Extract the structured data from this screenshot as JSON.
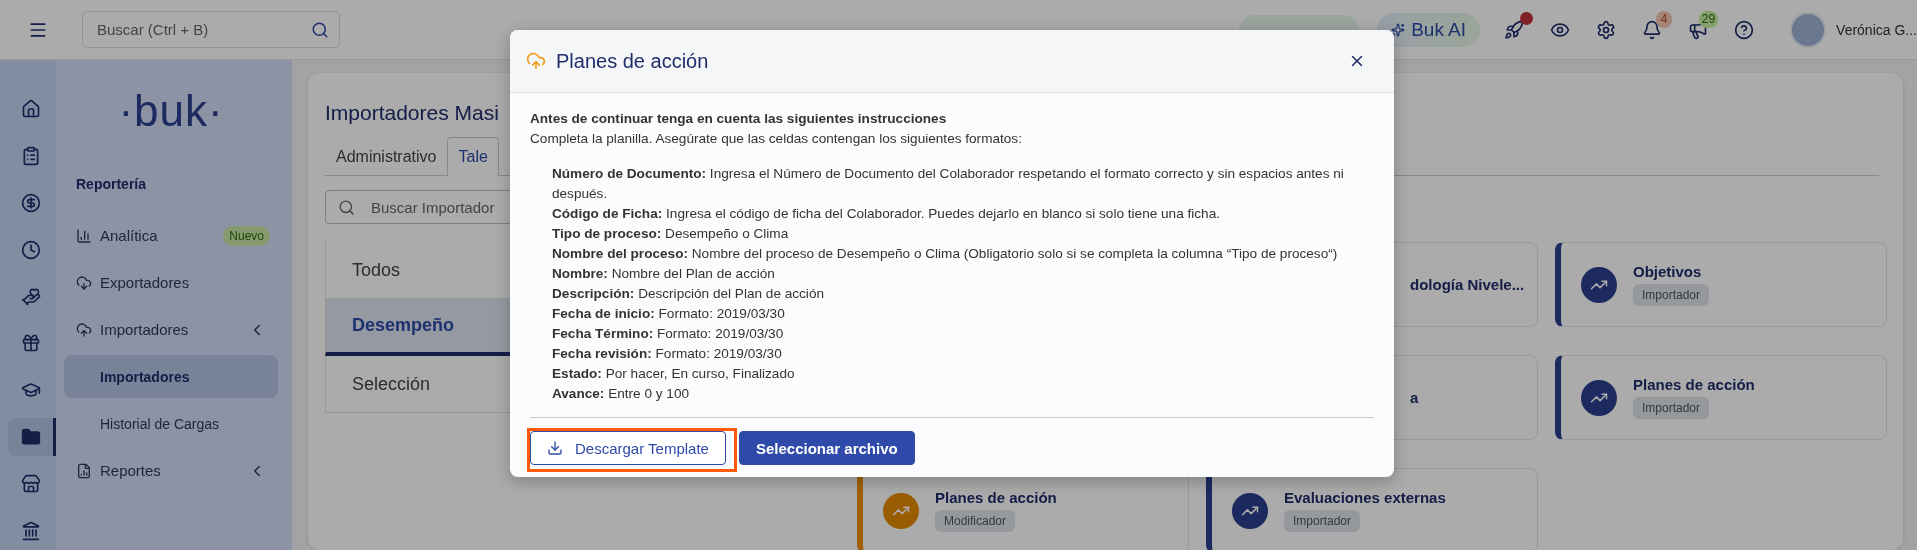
{
  "topbar": {
    "search": {
      "placeholder": "Buscar (Ctrl + B)"
    },
    "ai_button": "Buk AI",
    "actions": [
      {
        "kind": "rocket",
        "dot": true
      },
      {
        "kind": "eye"
      },
      {
        "kind": "gear"
      },
      {
        "kind": "bell",
        "count": "4"
      },
      {
        "kind": "megaphone",
        "count": "29"
      },
      {
        "kind": "help"
      }
    ],
    "user": {
      "name": "Verónica G..."
    }
  },
  "rail": [
    {
      "kind": "home",
      "selected": false
    },
    {
      "kind": "clipboard",
      "selected": false
    },
    {
      "kind": "dollar",
      "selected": false
    },
    {
      "kind": "clock",
      "selected": false
    },
    {
      "kind": "hand-heart",
      "selected": false
    },
    {
      "kind": "gift",
      "selected": false
    },
    {
      "kind": "cap",
      "selected": false
    },
    {
      "kind": "folder",
      "selected": true
    },
    {
      "kind": "store",
      "selected": false
    },
    {
      "kind": "bank",
      "selected": false
    }
  ],
  "sidebar": {
    "logo": "·buk·",
    "section": "Reportería",
    "items": [
      {
        "label": "Analítica",
        "kind": "chart",
        "badge": "Nuevo",
        "expandable": false
      },
      {
        "label": "Exportadores",
        "kind": "cloud-down",
        "expandable": false
      },
      {
        "label": "Importadores",
        "kind": "cloud-up",
        "expandable": true,
        "children": [
          {
            "label": "Importadores",
            "selected": true
          },
          {
            "label": "Historial de Cargas",
            "selected": false
          }
        ]
      },
      {
        "label": "Reportes",
        "kind": "report",
        "expandable": true
      }
    ]
  },
  "main": {
    "title": "Importadores Masi",
    "tabs": [
      {
        "label": "Administrativo",
        "selected": false
      },
      {
        "label": "Tale",
        "selected": true
      }
    ],
    "search": {
      "placeholder": "Buscar Importador"
    },
    "categories": [
      {
        "label": "Todos",
        "selected": false
      },
      {
        "label": "Desempeño",
        "selected": true
      },
      {
        "label": "Selección",
        "selected": false
      }
    ],
    "cards": [
      {
        "kind": "covered",
        "title": "dología Nivele..."
      },
      {
        "kind": "importer",
        "title": "Objetivos",
        "tag": "Importador"
      },
      {
        "kind": "covered",
        "title": "a"
      },
      {
        "kind": "importer",
        "title": "Planes de acción",
        "tag": "Importador"
      },
      {
        "kind": "modifier",
        "title": "Planes de acción",
        "tag": "Modificador"
      },
      {
        "kind": "importer",
        "title": "Evaluaciones externas",
        "tag": "Importador"
      }
    ]
  },
  "modal": {
    "title": "Planes de acción",
    "heading": "Antes de continuar tenga en cuenta las siguientes instrucciones",
    "intro": "Completa la planilla. Asegúrate que las celdas contengan los siguientes formatos:",
    "fields": [
      {
        "label": "Número de Documento:",
        "text": "Ingresa el Número de Documento del Colaborador respetando el formato correcto y sin espacios antes ni después."
      },
      {
        "label": "Código de Ficha:",
        "text": "Ingresa el código de ficha del Colaborador. Puedes dejarlo en blanco si solo tiene una ficha."
      },
      {
        "label": "Tipo de proceso:",
        "text": "Desempeño o Clima"
      },
      {
        "label": "Nombre del proceso:",
        "text": "Nombre del proceso de Desempeño o Clima (Obligatorio solo si se completa la columna “Tipo de proceso“)"
      },
      {
        "label": "Nombre:",
        "text": "Nombre del Plan de acción"
      },
      {
        "label": "Descripción:",
        "text": "Descripción del Plan de acción"
      },
      {
        "label": "Fecha de inicio:",
        "text": "Formato: 2019/03/30"
      },
      {
        "label": "Fecha Término:",
        "text": "Formato: 2019/03/30"
      },
      {
        "label": "Fecha revisión:",
        "text": "Formato: 2019/03/30"
      },
      {
        "label": "Estado:",
        "text": "Por hacer, En curso, Finalizado"
      },
      {
        "label": "Avance:",
        "text": "Entre 0 y 100"
      }
    ],
    "buttons": [
      {
        "label": "Descargar Template",
        "kind": "outline",
        "highlighted": true
      },
      {
        "label": "Seleccionar archivo",
        "kind": "primary",
        "highlighted": false
      }
    ]
  }
}
